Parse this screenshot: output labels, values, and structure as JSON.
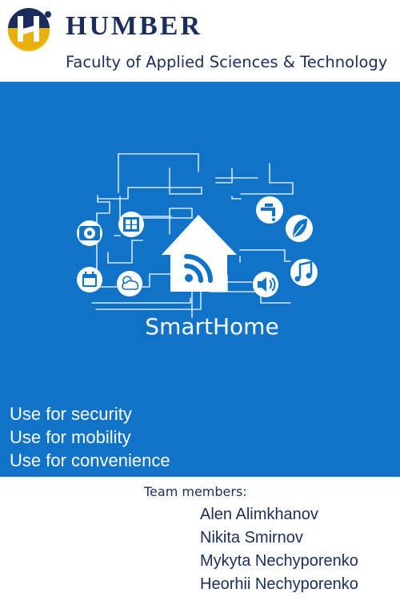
{
  "header": {
    "brand": "HUMBER",
    "faculty": "Faculty of Applied Sciences & Technology",
    "logo_icon": "humber-logo-icon"
  },
  "hero": {
    "product_name": "SmartHome",
    "icons": [
      "wifi-icon",
      "house-icon",
      "washing-machine-icon",
      "window-icon",
      "faucet-icon",
      "leaf-icon",
      "music-note-icon",
      "speaker-icon",
      "calendar-icon",
      "weather-icon"
    ],
    "uses": [
      "Use for security",
      "Use for mobility",
      "Use for convenience"
    ]
  },
  "team": {
    "title": "Team members:",
    "members": [
      "Alen Alimkhanov",
      "Nikita Smirnov",
      "Mykyta Nechyporenko",
      "Heorhii Nechyporenko"
    ]
  },
  "colors": {
    "brand_navy": "#1a2d5c",
    "panel_blue": "#1173c8",
    "logo_gold": "#f2b705",
    "logo_white": "#ffffff"
  }
}
